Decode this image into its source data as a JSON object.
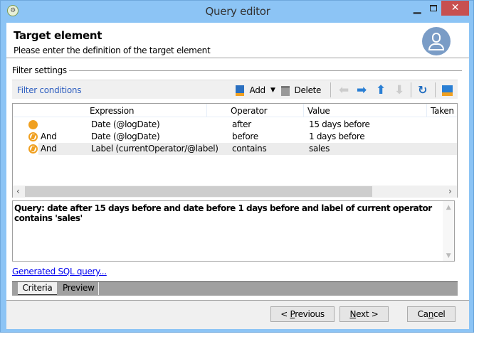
{
  "window": {
    "title": "Query editor",
    "close_icon": "close-icon",
    "minimize_icon": "minimize-icon",
    "maximize_icon": "maximize-icon"
  },
  "header": {
    "title": "Target element",
    "subtitle": "Please enter the definition of the target element",
    "avatar_icon": "user-icon"
  },
  "filter_settings": {
    "label": "Filter settings"
  },
  "toolbar": {
    "title": "Filter conditions",
    "add_label": "Add",
    "delete_label": "Delete"
  },
  "grid": {
    "columns": [
      "Expression",
      "Operator",
      "Value",
      "Taken"
    ],
    "rows": [
      {
        "link": "",
        "expression": "Date (@logDate)",
        "operator": "after",
        "value": "15 days before",
        "selected": false
      },
      {
        "link": "And",
        "expression": "Date (@logDate)",
        "operator": "before",
        "value": "1 days before",
        "selected": false
      },
      {
        "link": "And",
        "expression": "Label (currentOperator/@label)",
        "operator": "contains",
        "value": "sales",
        "selected": true
      }
    ]
  },
  "query": {
    "text": "Query: date after 15 days before and date before 1 days before and label of current operator contains 'sales'"
  },
  "sql_link": "Generated SQL query...",
  "tabs": [
    {
      "label": "Criteria",
      "active": true
    },
    {
      "label": "Preview",
      "active": false
    }
  ],
  "footer": {
    "previous": {
      "pre": "< ",
      "key": "P",
      "post": "revious"
    },
    "next": {
      "pre": "",
      "key": "N",
      "post": "ext >"
    },
    "cancel": {
      "pre": "Ca",
      "key": "n",
      "post": "cel"
    }
  },
  "colors": {
    "titlebar": "#8cc4f5",
    "close": "#c75050",
    "link": "#3060c0",
    "condition": "#f0a020"
  }
}
